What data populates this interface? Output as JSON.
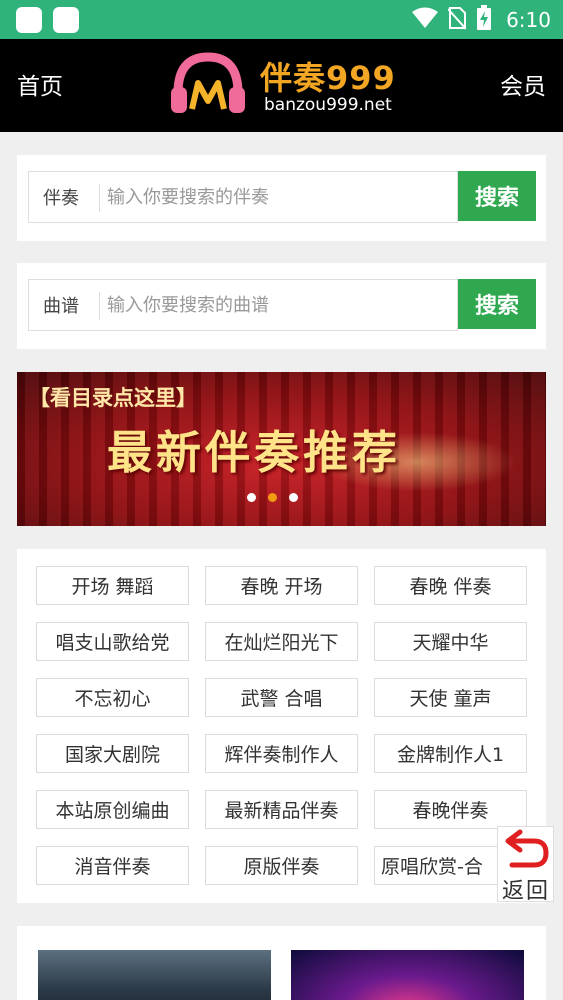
{
  "status_bar": {
    "time": "6:10",
    "icons": [
      "app-icon",
      "app-icon",
      "wifi-icon",
      "no-sim-icon",
      "battery-charging-icon"
    ]
  },
  "header": {
    "left_link": "首页",
    "right_link": "会员",
    "logo": {
      "name": "伴奏999",
      "domain": "banzou999.net"
    }
  },
  "search_accompaniment": {
    "label": "伴奏",
    "placeholder": "输入你要搜索的伴奏",
    "value": "",
    "button": "搜索"
  },
  "search_score": {
    "label": "曲谱",
    "placeholder": "输入你要搜索的曲谱",
    "value": "",
    "button": "搜索"
  },
  "banner": {
    "subtitle": "【看目录点这里】",
    "title": "最新伴奏推荐",
    "slides": 3,
    "active_slide": 2
  },
  "tags": [
    "开场 舞蹈",
    "春晚 开场",
    "春晚 伴奏",
    "唱支山歌给党",
    "在灿烂阳光下",
    "天耀中华",
    "不忘初心",
    "武警 合唱",
    "天使 童声",
    "国家大剧院",
    "辉伴奏制作人",
    "金牌制作人1",
    "本站原创编曲",
    "最新精品伴奏",
    "春晚伴奏",
    "消音伴奏",
    "原版伴奏",
    "原唱欣赏-合"
  ],
  "back_button": {
    "label": "返回"
  },
  "colors": {
    "status_bar": "#2fb37b",
    "header": "#000000",
    "accent_green": "#2fa84f",
    "dot_active": "#f39c12"
  }
}
